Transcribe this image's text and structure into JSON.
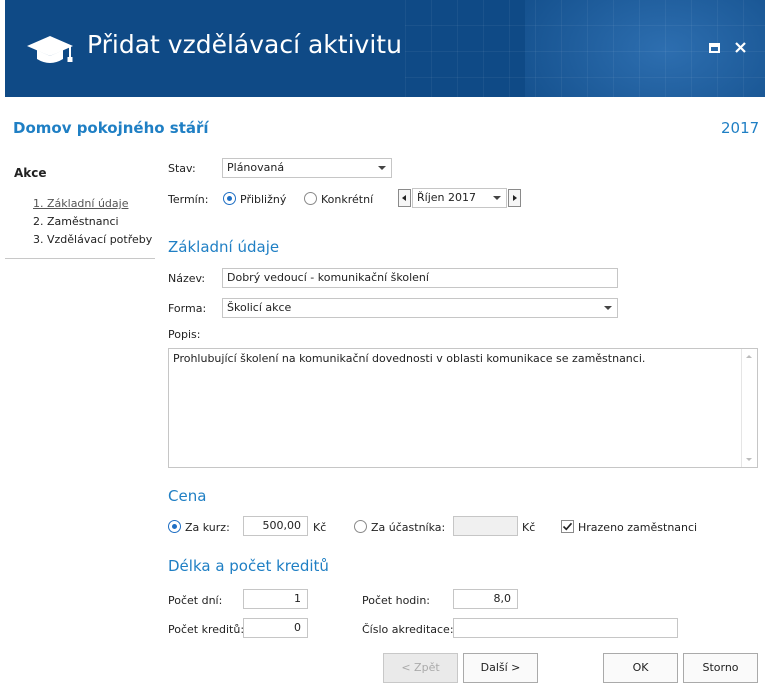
{
  "window": {
    "title": "Přidat vzdělávací aktivitu",
    "maximize_icon": "maximize-icon",
    "close_icon": "close-icon",
    "title_icon": "graduation-cap-icon",
    "header_color": "#0f4a86"
  },
  "header": {
    "organization": "Domov pokojného stáří",
    "year": "2017"
  },
  "sidebar": {
    "title": "Akce",
    "items": [
      {
        "label": "1. Základní údaje",
        "active": true
      },
      {
        "label": "2. Zaměstnanci",
        "active": false
      },
      {
        "label": "3. Vzdělávací potřeby",
        "active": false
      }
    ]
  },
  "status": {
    "label": "Stav:",
    "value": "Plánovaná"
  },
  "term": {
    "label": "Termín:",
    "option_approx": "Přibližný",
    "option_exact": "Konkrétní",
    "selected": "Přibližný",
    "month_value": "Říjen 2017"
  },
  "basic": {
    "heading": "Základní údaje",
    "name_label": "Název:",
    "name_value": "Dobrý vedoucí - komunikační školení",
    "form_label": "Forma:",
    "form_value": "Školicí akce",
    "desc_label": "Popis:",
    "desc_value": "Prohlubující školení na komunikační dovednosti v oblasti komunikace se zaměstnanci."
  },
  "price": {
    "heading": "Cena",
    "per_course_label": "Za kurz:",
    "per_course_value": "500,00",
    "currency": "Kč",
    "per_participant_label": "Za účastníka:",
    "per_participant_value": "",
    "paid_by_employees_label": "Hrazeno zaměstnanci",
    "paid_by_employees": true,
    "selected": "Za kurz"
  },
  "length": {
    "heading": "Délka a počet kreditů",
    "days_label": "Počet dní:",
    "days_value": "1",
    "hours_label": "Počet hodin:",
    "hours_value": "8,0",
    "credits_label": "Počet kreditů:",
    "credits_value": "0",
    "accreditation_label": "Číslo akreditace:",
    "accreditation_value": ""
  },
  "buttons": {
    "back": "< Zpět",
    "next": "Další >",
    "ok": "OK",
    "cancel": "Storno"
  }
}
